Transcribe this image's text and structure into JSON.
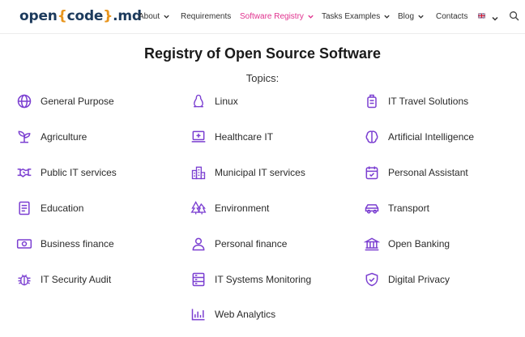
{
  "header": {
    "logo": {
      "part1": "open",
      "brace_open": "{",
      "part2": "code",
      "brace_close": "}",
      "part3": ".md"
    },
    "nav": [
      {
        "label": "About",
        "has_dropdown": true,
        "active": false
      },
      {
        "label": "Requirements",
        "has_dropdown": false,
        "active": false
      },
      {
        "label": "Software Registry",
        "has_dropdown": true,
        "active": true
      },
      {
        "label": "Tasks Examples",
        "has_dropdown": true,
        "active": false
      },
      {
        "label": "Blog",
        "has_dropdown": true,
        "active": false
      },
      {
        "label": "Contacts",
        "has_dropdown": false,
        "active": false
      }
    ],
    "language_icon": "uk-flag-icon",
    "search_icon": "search-icon"
  },
  "page": {
    "title": "Registry of Open Source Software",
    "subtitle": "Topics:"
  },
  "topics": [
    {
      "label": "General Purpose",
      "icon": "globe-icon"
    },
    {
      "label": "Linux",
      "icon": "penguin-icon"
    },
    {
      "label": "IT Travel Solutions",
      "icon": "suitcase-icon"
    },
    {
      "label": "Agriculture",
      "icon": "sprout-icon"
    },
    {
      "label": "Healthcare IT",
      "icon": "medical-laptop-icon"
    },
    {
      "label": "Artificial Intelligence",
      "icon": "brain-icon"
    },
    {
      "label": "Public IT services",
      "icon": "handshake-icon"
    },
    {
      "label": "Municipal IT services",
      "icon": "city-icon"
    },
    {
      "label": "Personal Assistant",
      "icon": "calendar-check-icon"
    },
    {
      "label": "Education",
      "icon": "book-icon"
    },
    {
      "label": "Environment",
      "icon": "trees-icon"
    },
    {
      "label": "Transport",
      "icon": "car-icon"
    },
    {
      "label": "Business finance",
      "icon": "banknote-icon"
    },
    {
      "label": "Personal finance",
      "icon": "user-icon"
    },
    {
      "label": "Open Banking",
      "icon": "bank-icon"
    },
    {
      "label": "IT Security Audit",
      "icon": "bug-icon"
    },
    {
      "label": "IT Systems Monitoring",
      "icon": "server-icon"
    },
    {
      "label": "Digital Privacy",
      "icon": "shield-check-icon"
    },
    {
      "label": "Web Analytics",
      "icon": "bar-chart-icon"
    }
  ],
  "colors": {
    "accent": "#e0328e",
    "icon_purple": "#7b3fd1",
    "logo_dark": "#1c3a5c",
    "logo_brace": "#e8951d"
  }
}
